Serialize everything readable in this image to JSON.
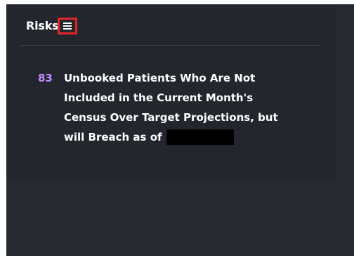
{
  "widget": {
    "title": "Risks",
    "list_icon": "list-icon"
  },
  "risk": {
    "count": "83",
    "text": "Unbooked Patients Who Are Not Included in the Current Month's Census Over Target Projections, but will Breach as of",
    "redacted": true
  },
  "colors": {
    "panel_bg": "#22252c",
    "card_bg": "#23262d",
    "divider": "#3a3d45",
    "count_color": "#c38bff",
    "text_color": "#ffffff",
    "highlight_border": "#e3242b"
  }
}
